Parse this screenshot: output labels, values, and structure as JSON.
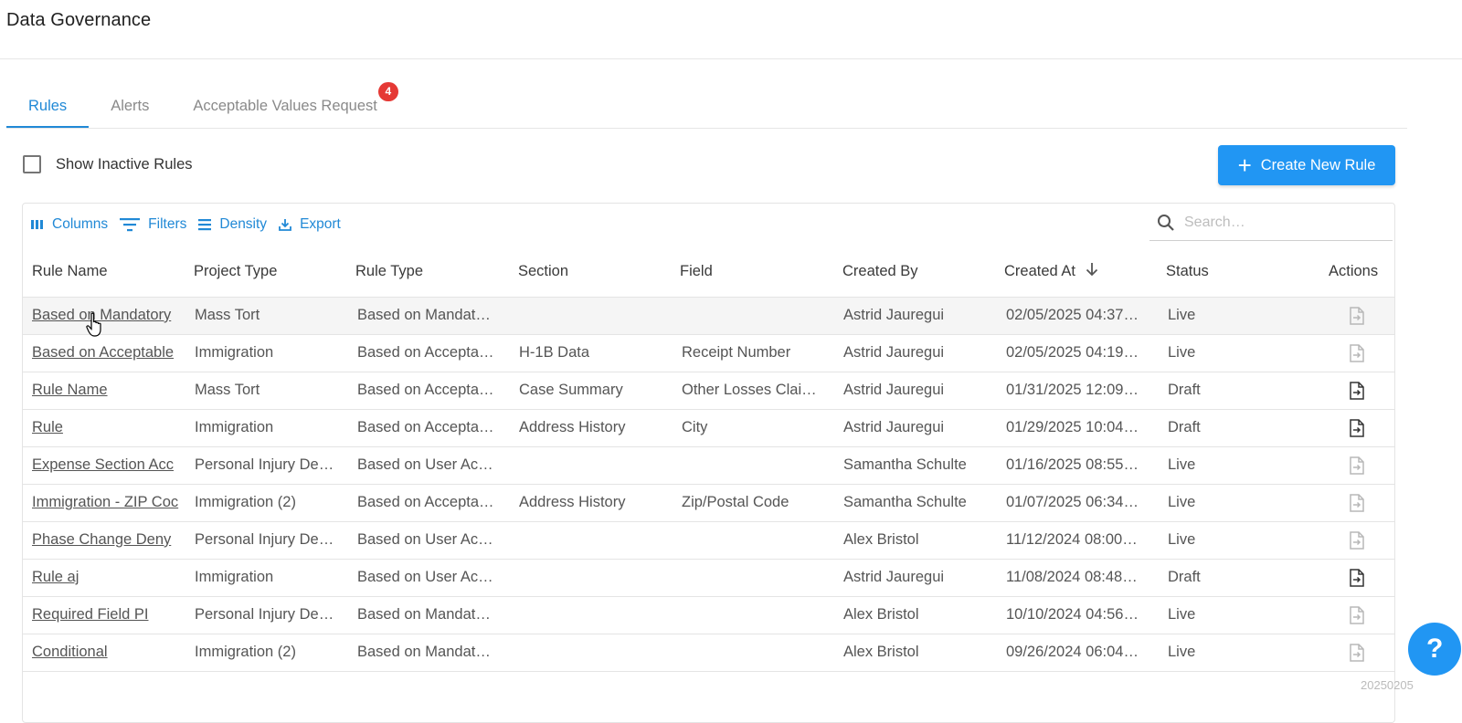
{
  "header": {
    "title": "Data Governance"
  },
  "tabs": [
    {
      "label": "Rules",
      "active": true
    },
    {
      "label": "Alerts",
      "active": false
    },
    {
      "label": "Acceptable Values Request",
      "active": false,
      "badge": "4"
    }
  ],
  "filters": {
    "show_inactive_label": "Show Inactive Rules",
    "show_inactive_checked": false
  },
  "create_button": {
    "label": "Create New Rule",
    "icon": "plus-icon"
  },
  "toolbar": {
    "columns": "Columns",
    "filters": "Filters",
    "density": "Density",
    "export": "Export"
  },
  "search": {
    "placeholder": "Search…"
  },
  "table": {
    "columns": [
      "Rule Name",
      "Project Type",
      "Rule Type",
      "Section",
      "Field",
      "Created By",
      "Created At",
      "Status",
      "Actions"
    ],
    "sort": {
      "column": "Created At",
      "direction": "desc"
    },
    "rows": [
      {
        "rule_name": "Based on Mandatory",
        "project_type": "Mass Tort",
        "rule_type": "Based on Mandat…",
        "section": "",
        "field": "",
        "created_by": "Astrid Jauregui",
        "created_at": "02/05/2025 04:37…",
        "status": "Live"
      },
      {
        "rule_name": "Based on Acceptable",
        "project_type": "Immigration",
        "rule_type": "Based on Accepta…",
        "section": "H-1B Data",
        "field": "Receipt Number",
        "created_by": "Astrid Jauregui",
        "created_at": "02/05/2025 04:19…",
        "status": "Live"
      },
      {
        "rule_name": "Rule Name",
        "project_type": "Mass Tort",
        "rule_type": "Based on Accepta…",
        "section": "Case Summary",
        "field": "Other Losses Clai…",
        "created_by": "Astrid Jauregui",
        "created_at": "01/31/2025 12:09…",
        "status": "Draft"
      },
      {
        "rule_name": "Rule",
        "project_type": "Immigration",
        "rule_type": "Based on Accepta…",
        "section": "Address History",
        "field": "City",
        "created_by": "Astrid Jauregui",
        "created_at": "01/29/2025 10:04…",
        "status": "Draft"
      },
      {
        "rule_name": "Expense Section Acc",
        "project_type": "Personal Injury De…",
        "rule_type": "Based on User Ac…",
        "section": "",
        "field": "",
        "created_by": "Samantha Schulte",
        "created_at": "01/16/2025 08:55…",
        "status": "Live"
      },
      {
        "rule_name": "Immigration - ZIP Coc",
        "project_type": "Immigration (2)",
        "rule_type": "Based on Accepta…",
        "section": "Address History",
        "field": "Zip/Postal Code",
        "created_by": "Samantha Schulte",
        "created_at": "01/07/2025 06:34…",
        "status": "Live"
      },
      {
        "rule_name": "Phase Change Deny",
        "project_type": "Personal Injury De…",
        "rule_type": "Based on User Ac…",
        "section": "",
        "field": "",
        "created_by": "Alex Bristol",
        "created_at": "11/12/2024 08:00…",
        "status": "Live"
      },
      {
        "rule_name": "Rule aj",
        "project_type": "Immigration",
        "rule_type": "Based on User Ac…",
        "section": "",
        "field": "",
        "created_by": "Astrid Jauregui",
        "created_at": "11/08/2024 08:48…",
        "status": "Draft"
      },
      {
        "rule_name": "Required Field PI",
        "project_type": "Personal Injury De…",
        "rule_type": "Based on Mandat…",
        "section": "",
        "field": "",
        "created_by": "Alex Bristol",
        "created_at": "10/10/2024 04:56…",
        "status": "Live"
      },
      {
        "rule_name": "Conditional",
        "project_type": "Immigration (2)",
        "rule_type": "Based on Mandat…",
        "section": "",
        "field": "",
        "created_by": "Alex Bristol",
        "created_at": "09/26/2024 06:04…",
        "status": "Live"
      }
    ]
  },
  "help_button": {
    "label": "?"
  },
  "watermark": "20250205",
  "colors": {
    "accent": "#2196f3",
    "link_blue": "#2189d6",
    "badge_red": "#e53935"
  }
}
